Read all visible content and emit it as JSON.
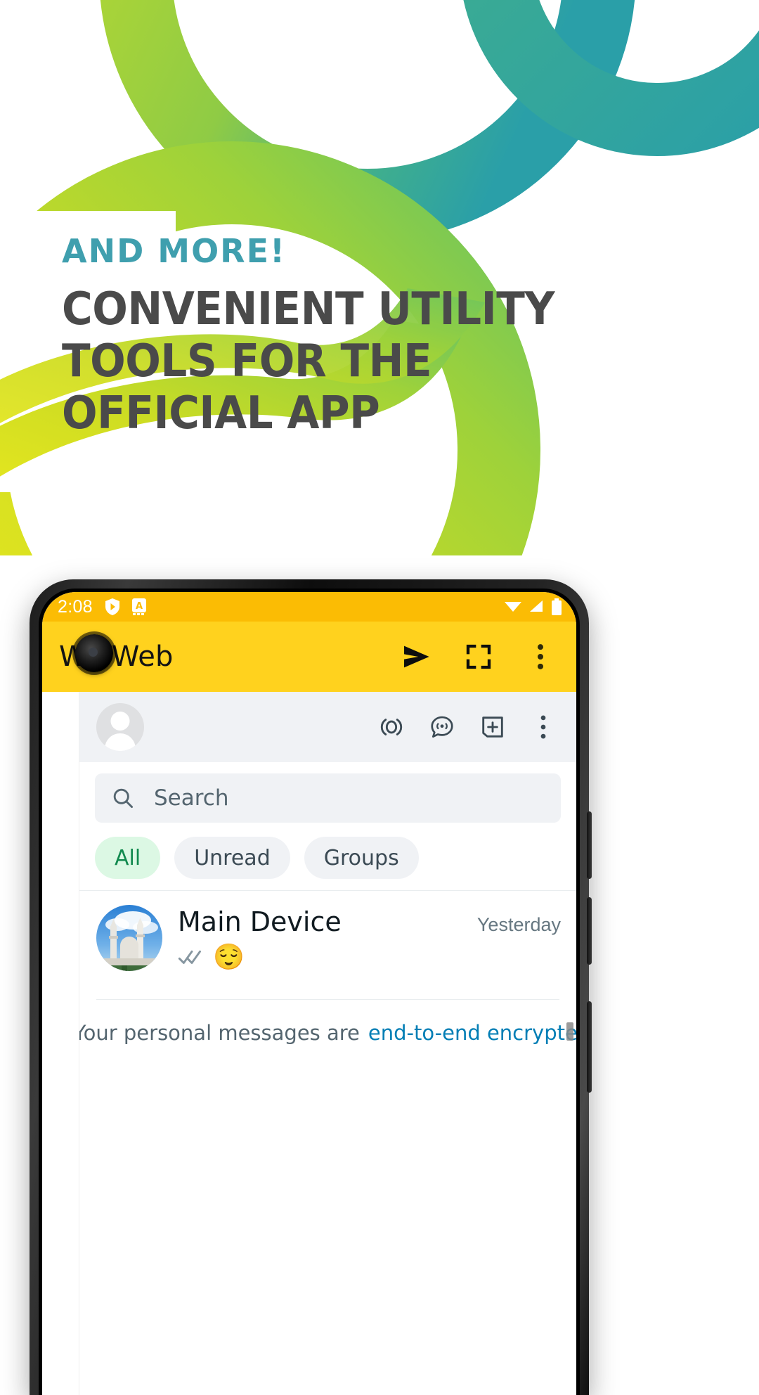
{
  "promo": {
    "eyebrow": "AND MORE!",
    "headline_lines": [
      "CONVENIENT UTILITY",
      "TOOLS FOR THE",
      "OFFICIAL APP"
    ],
    "eyebrow_color": "#3f9fae",
    "headline_color": "#4a4a4a",
    "accent_green": "#9ed23a",
    "accent_yellow": "#e9e81f",
    "accent_teal": "#2a9fa8"
  },
  "phone": {
    "statusbar": {
      "time": "2:08",
      "icons_left": [
        "play-protect-icon",
        "app-badge-icon"
      ],
      "icons_right": [
        "signal-icon",
        "wifi-icon",
        "battery-icon"
      ]
    },
    "appbar": {
      "title": "Wa Web",
      "background": "#FFD21E",
      "actions": [
        "send-icon",
        "fullscreen-icon",
        "overflow-menu-icon"
      ]
    }
  },
  "webview": {
    "header": {
      "avatar": "profile-avatar",
      "actions": [
        "meta-ai-icon",
        "status-icon",
        "new-chat-icon",
        "overflow-menu-icon"
      ]
    },
    "search": {
      "placeholder": "Search",
      "icon": "search-icon"
    },
    "filters": [
      {
        "label": "All",
        "active": true
      },
      {
        "label": "Unread",
        "active": false
      },
      {
        "label": "Groups",
        "active": false
      }
    ],
    "chats": [
      {
        "name": "Main Device",
        "time": "Yesterday",
        "preview_emoji": "😌",
        "read_status": "double-check",
        "avatar_alt": "mosque-photo"
      }
    ],
    "encryption_notice": {
      "icon": "lock-icon",
      "text": "Your personal messages are",
      "link_text": "end-to-end encrypted",
      "link_color": "#027eb5"
    }
  }
}
